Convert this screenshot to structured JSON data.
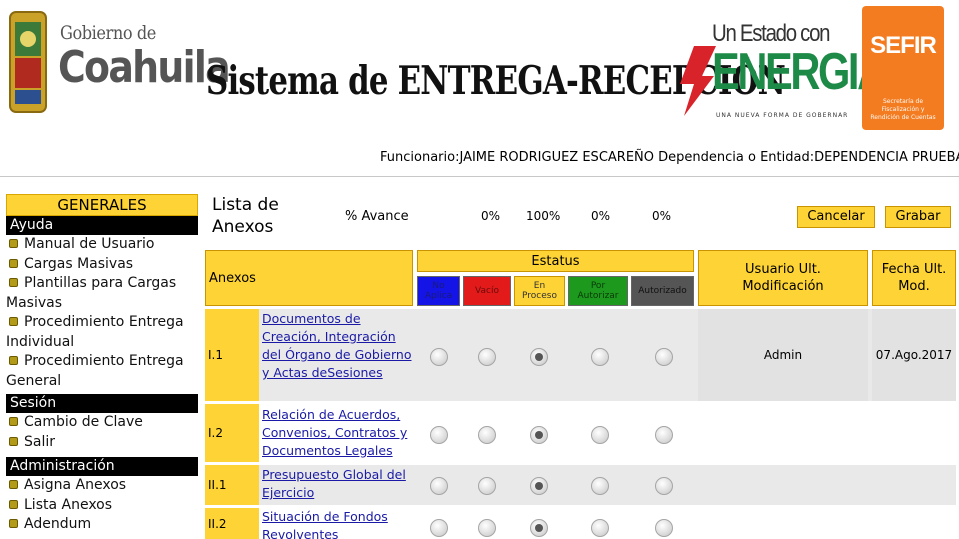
{
  "header": {
    "gov_small": "Gobierno de",
    "gov_big": "Coahuila",
    "system_title": "Sistema de ENTREGA-RECEPCIÓN",
    "energia_top": "Un Estado con",
    "energia_big": "ENERGIA",
    "energia_tag": "UNA NUEVA FORMA DE GOBERNAR",
    "sefir_name": "SEFIR",
    "sefir_sub": "Secretaría de Fiscalización y Rendición de Cuentas",
    "brand_colors": {
      "energia_green": "#1e8a47",
      "energia_red": "#d8232a",
      "sefir_orange": "#f47c20",
      "accent_yellow": "#fdd335"
    }
  },
  "user_info": {
    "funcionario_label": "Funcionario:",
    "funcionario": "JAIME RODRIGUEZ ESCAREÑO",
    "dependencia_label": " Dependencia o Entidad:",
    "dependencia": "DEPENDENCIA PRUEBA"
  },
  "sidebar": {
    "title": "GENERALES",
    "sections": [
      {
        "title": "Ayuda",
        "items": [
          "Manual de Usuario",
          "Cargas Masivas",
          "Plantillas para Cargas Masivas",
          "Procedimiento Entrega Individual",
          "Procedimiento Entrega General"
        ]
      },
      {
        "title": "Sesión",
        "items": [
          "Cambio de Clave",
          "Salir"
        ]
      },
      {
        "title": "Administración",
        "items": [
          "Asigna Anexos",
          "Lista Anexos",
          "Adendum"
        ]
      }
    ]
  },
  "main": {
    "list_title": "Lista de Anexos",
    "avance_label": "% Avance",
    "avance_values": [
      "0%",
      "100%",
      "0%",
      "0%"
    ],
    "buttons": {
      "cancel": "Cancelar",
      "save": "Grabar"
    },
    "table": {
      "col_anexos": "Anexos",
      "col_estatus": "Estatus",
      "col_usuario": "Usuario Ult. Modificación",
      "col_fecha": "Fecha Ult. Mod.",
      "status_columns": [
        {
          "label": "No Aplica",
          "color": "#1414e6"
        },
        {
          "label": "Vacío",
          "color": "#e31a1a"
        },
        {
          "label": "En Proceso",
          "color": "#fdd335"
        },
        {
          "label": "Por Autorizar",
          "color": "#1d9a1d"
        },
        {
          "label": "Autorizado",
          "color": "#555555"
        }
      ],
      "rows": [
        {
          "code": "I.1",
          "name": "Documentos de Creación, Integración del Órgano de Gobierno y Actas deSesiones",
          "selected_status": "En Proceso",
          "user": "Admin",
          "date": "07.Ago.2017"
        },
        {
          "code": "I.2",
          "name": "Relación de Acuerdos, Convenios, Contratos y Documentos Legales",
          "selected_status": "En Proceso",
          "user": "",
          "date": ""
        },
        {
          "code": "II.1",
          "name": "Presupuesto Global del Ejercicio",
          "selected_status": "En Proceso",
          "user": "",
          "date": ""
        },
        {
          "code": "II.2",
          "name": "Situación de Fondos Revolventes",
          "selected_status": "En Proceso",
          "user": "",
          "date": ""
        }
      ]
    }
  }
}
